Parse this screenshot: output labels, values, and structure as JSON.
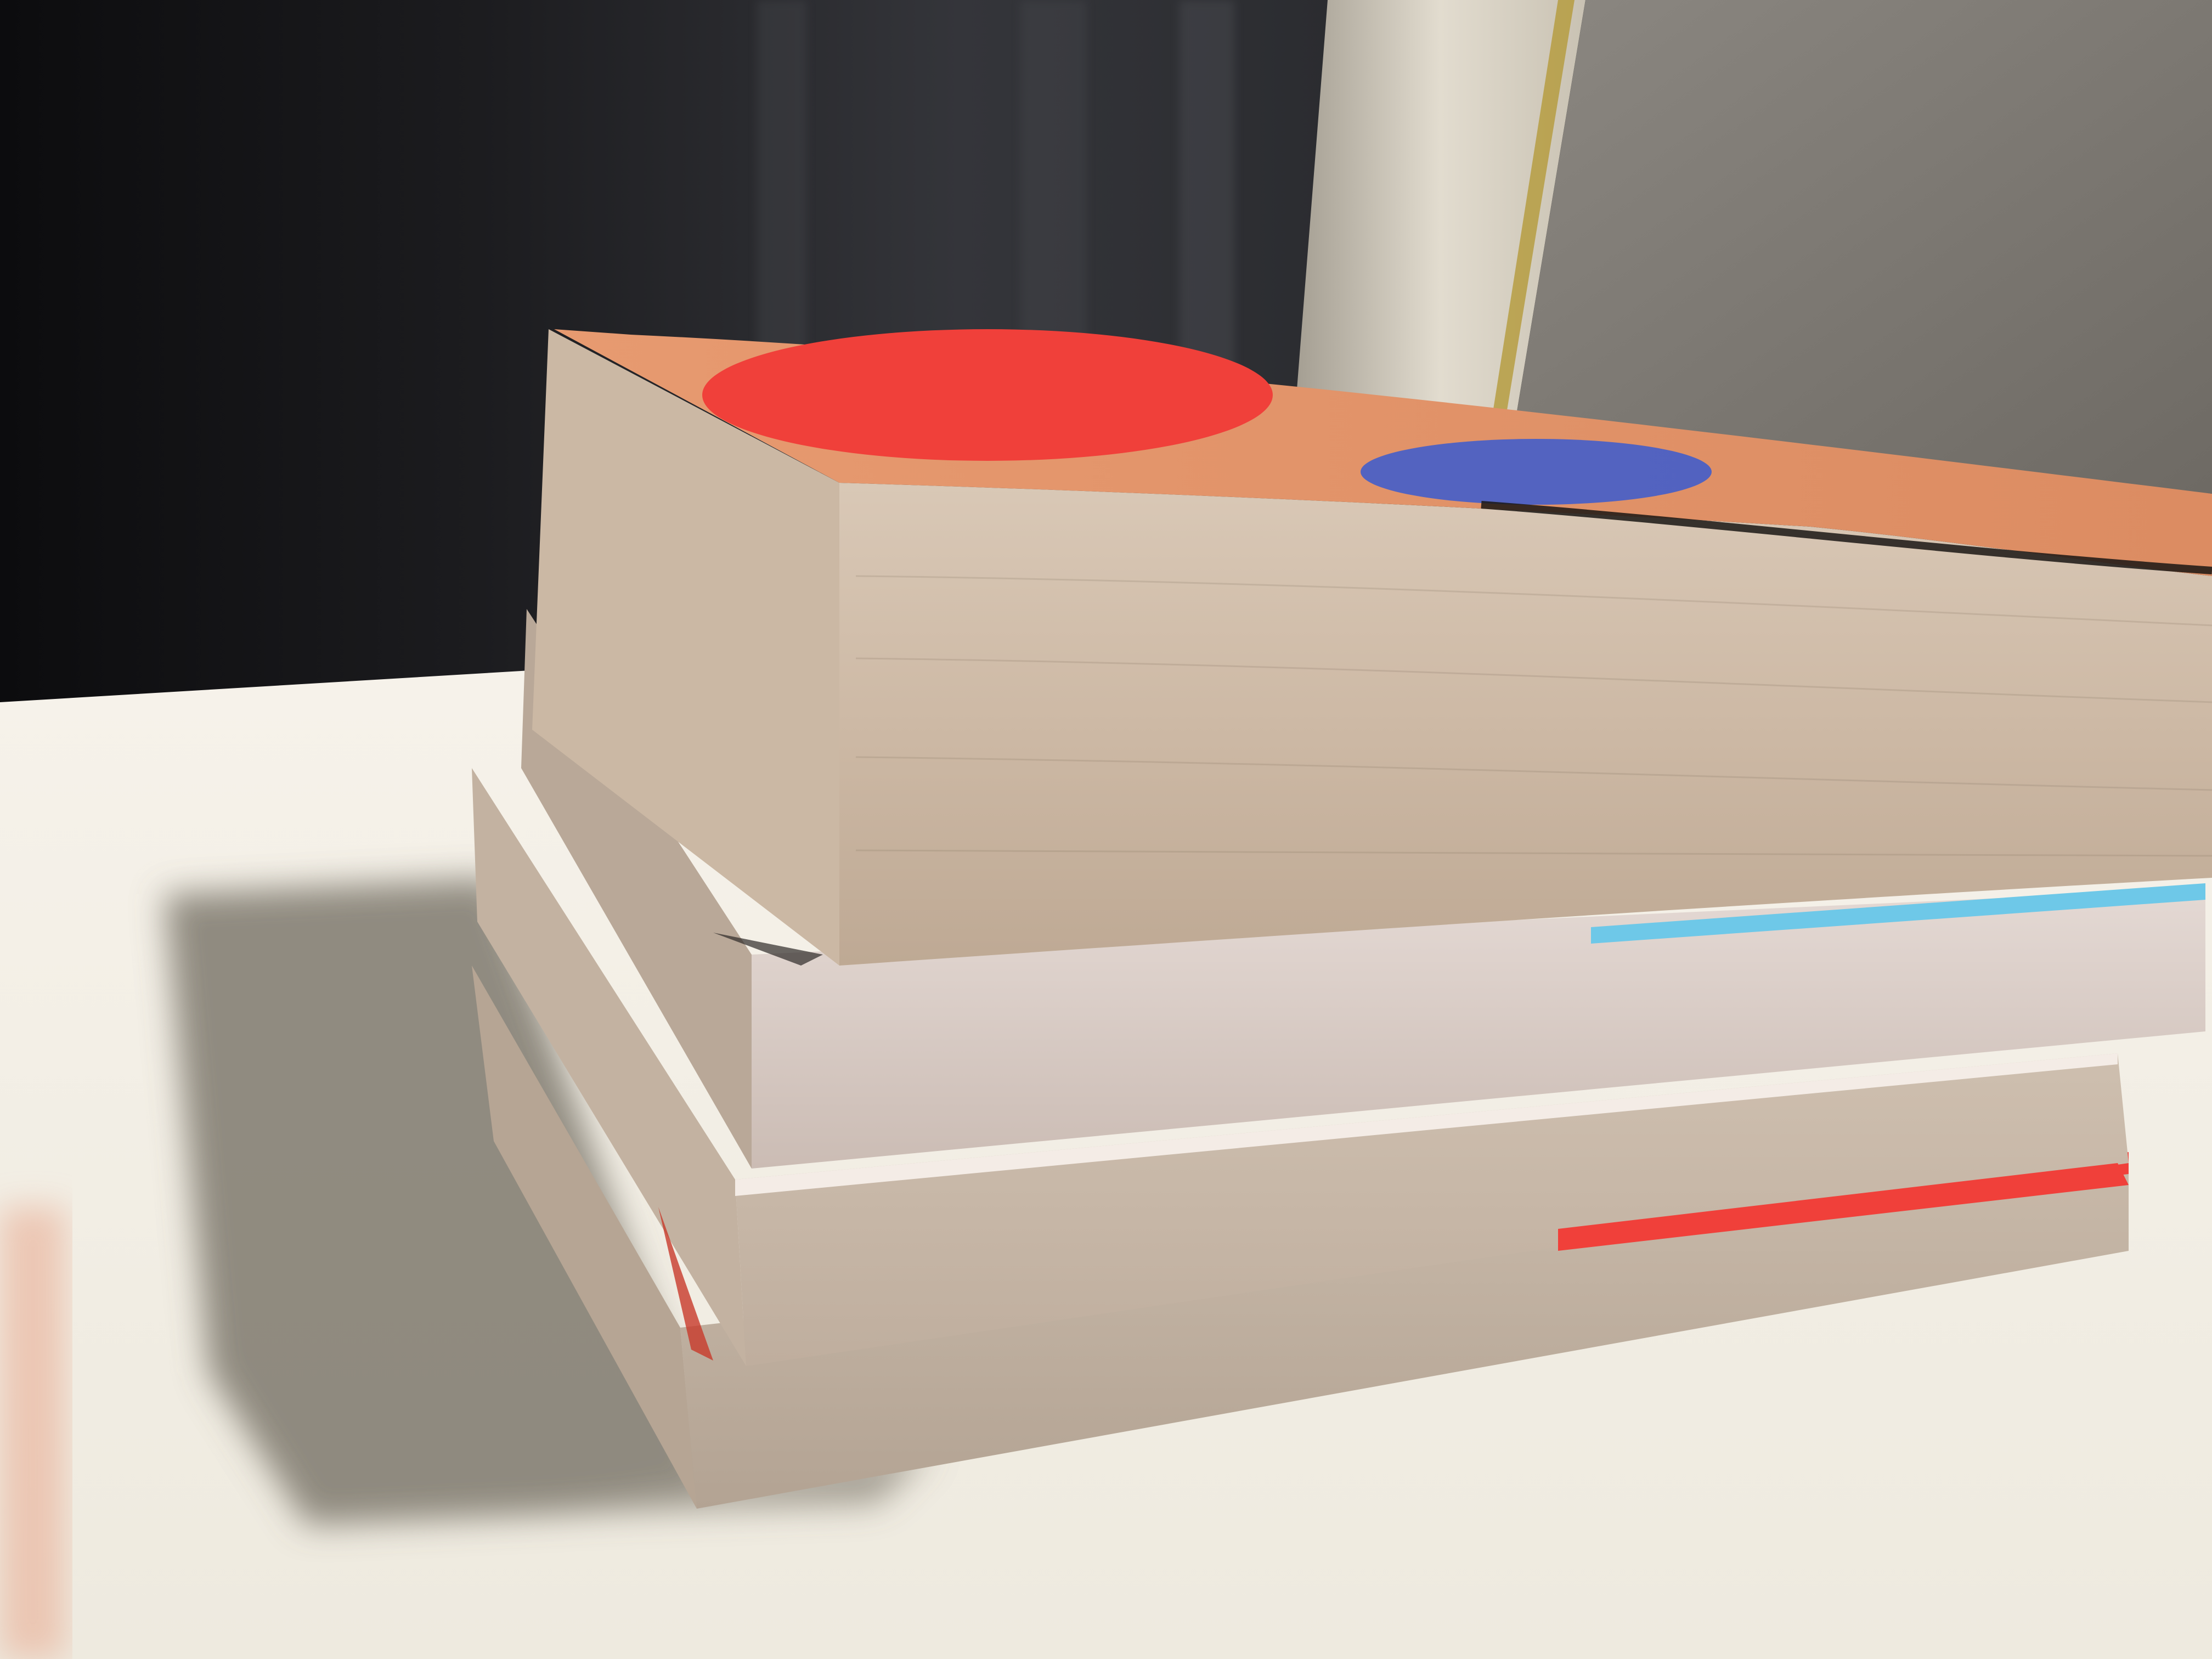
{
  "photo": {
    "subject": "stack-of-paperback-books",
    "book_count": 4
  },
  "colors": {
    "curtain_dark": "#141414",
    "curtain_mid": "#3a3a3c",
    "wall": "#7a7670",
    "window_frame": "#d8d2c4",
    "window_trim_gold": "#b49a3a",
    "desk_surface": "#f3efe6",
    "shadow": "#8a8476",
    "page_edge": "#cdbfae",
    "page_edge_light": "#e3d8cc",
    "cover_orange": "#e89a6a",
    "cover_red": "#f0403a",
    "cover_blue": "#3a5ad0",
    "cover_cyan": "#6ec8e8"
  }
}
